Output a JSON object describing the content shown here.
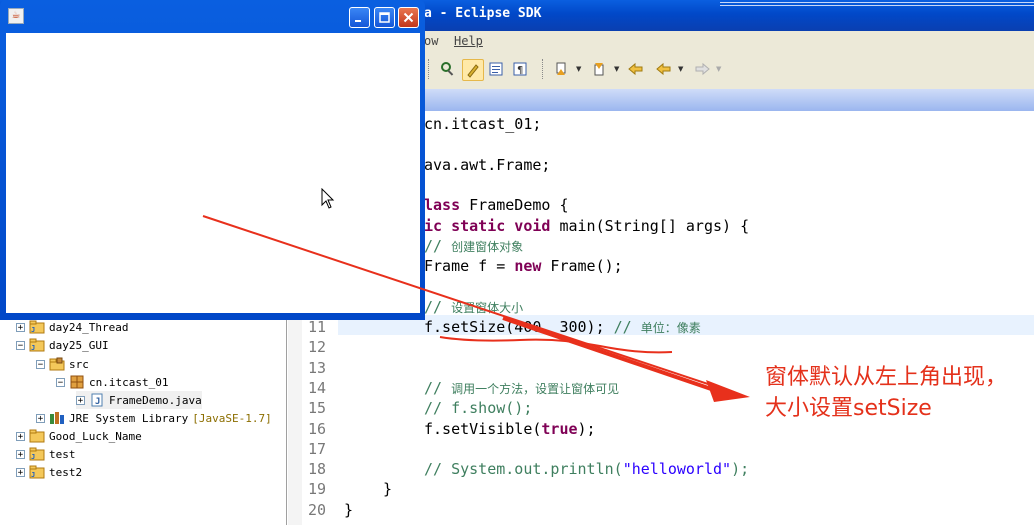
{
  "eclipse": {
    "title": "a - Eclipse SDK",
    "menu": [
      {
        "label": "ow"
      },
      {
        "label": "Help"
      }
    ]
  },
  "package_explorer": {
    "items": [
      {
        "label": "day24_Thread",
        "expander": "+"
      },
      {
        "label": "day25_GUI",
        "expander": "-"
      },
      {
        "label": "src",
        "expander": "-"
      },
      {
        "label": "cn.itcast_01",
        "expander": "-"
      },
      {
        "label": "FrameDemo.java",
        "expander": "+"
      },
      {
        "label": "JRE System Library",
        "suffix": "[JavaSE-1.7]",
        "expander": "+"
      },
      {
        "label": "Good_Luck_Name",
        "expander": "+"
      },
      {
        "label": "test",
        "expander": "+"
      },
      {
        "label": "test2",
        "expander": "+"
      }
    ]
  },
  "editor": {
    "lines": [
      {
        "num": "",
        "text": "cn.itcast_01;"
      },
      {
        "num": "",
        "text": ""
      },
      {
        "num": "",
        "text": "ava.awt.Frame;"
      },
      {
        "num": "",
        "text": ""
      },
      {
        "num": "",
        "kw": "lass",
        "text": " FrameDemo {"
      },
      {
        "num": "",
        "kw": "ic static void",
        "text": " main(String[] args) {"
      },
      {
        "num": "",
        "cm": "// ",
        "cn": "创建窗体对象"
      },
      {
        "num": "",
        "pre": "Frame f = ",
        "kw": "new",
        "text": " Frame();"
      },
      {
        "num": "",
        "text": ""
      },
      {
        "num": "",
        "cm": "// ",
        "cn": "设置窗体大小"
      },
      {
        "num": "11",
        "text": "f.setSize(400, 300); ",
        "cm": "// ",
        "cn": "单位：像素"
      },
      {
        "num": "12",
        "text": ""
      },
      {
        "num": "13",
        "text": ""
      },
      {
        "num": "14",
        "cm": "// ",
        "cn": "调用一个方法，设置让窗体可见"
      },
      {
        "num": "15",
        "cm": "// f.show();"
      },
      {
        "num": "16",
        "pre": "f.setVisible(",
        "kw": "true",
        "text": ");"
      },
      {
        "num": "17",
        "text": ""
      },
      {
        "num": "18",
        "cm": "// System.out.println(",
        "str": "\"helloworld\"",
        "cm2": ");"
      },
      {
        "num": "19",
        "text": "}"
      },
      {
        "num": "20",
        "text": "}"
      }
    ]
  },
  "annotation": {
    "text": "窗体默认从左上角出现，大小设置setSize",
    "color": "#e4311b"
  },
  "frame_window": {
    "buttons": [
      "minimize",
      "maximize",
      "close"
    ]
  },
  "colors": {
    "title_blue": "#0148c8",
    "keyword": "#7f0055",
    "comment": "#3f7f5f",
    "string": "#2a00ff"
  }
}
